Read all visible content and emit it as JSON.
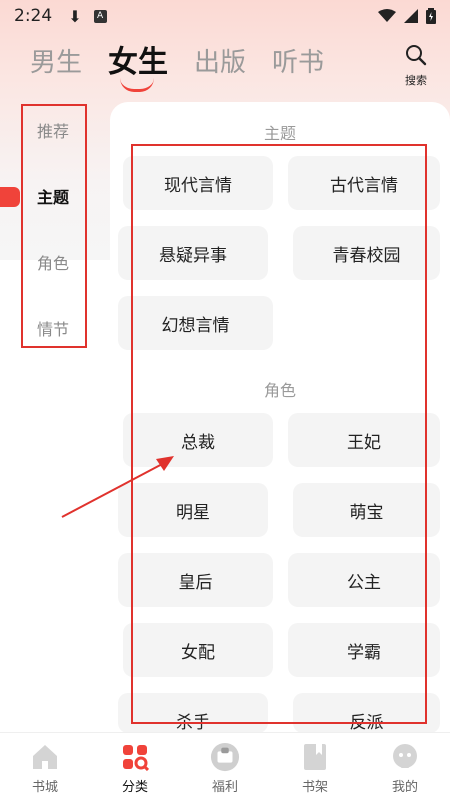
{
  "status_bar": {
    "time": "2:24",
    "download_glyph": "⬇",
    "app_badge": "A"
  },
  "top_tabs": [
    {
      "label": "男生",
      "active": false
    },
    {
      "label": "女生",
      "active": true
    },
    {
      "label": "出版",
      "active": false
    },
    {
      "label": "听书",
      "active": false
    }
  ],
  "search": {
    "label": "搜索"
  },
  "sidebar": {
    "items": [
      {
        "label": "推荐",
        "active": false
      },
      {
        "label": "主题",
        "active": true
      },
      {
        "label": "角色",
        "active": false
      },
      {
        "label": "情节",
        "active": false
      }
    ]
  },
  "sections": {
    "theme": {
      "title": "主题",
      "items": [
        "现代言情",
        "古代言情",
        "悬疑异事",
        "青春校园",
        "幻想言情"
      ]
    },
    "role": {
      "title": "角色",
      "items": [
        "总裁",
        "王妃",
        "明星",
        "萌宝",
        "皇后",
        "公主",
        "女配",
        "学霸",
        "杀手",
        "反派"
      ]
    }
  },
  "bottom_nav": [
    {
      "label": "书城",
      "active": false
    },
    {
      "label": "分类",
      "active": true
    },
    {
      "label": "福利",
      "active": false
    },
    {
      "label": "书架",
      "active": false
    },
    {
      "label": "我的",
      "active": false
    }
  ],
  "colors": {
    "accent": "#f0433a",
    "annotation": "#e0322d"
  }
}
